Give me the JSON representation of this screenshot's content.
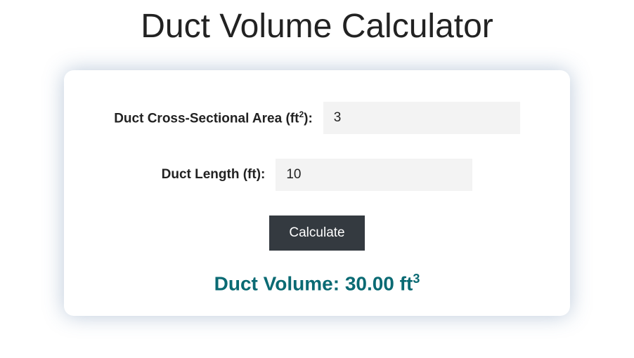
{
  "title": "Duct Volume Calculator",
  "form": {
    "area_label_pre": "Duct Cross-Sectional Area (ft",
    "area_label_sup": "2",
    "area_label_post": "):",
    "area_value": "3",
    "length_label": "Duct Length (ft):",
    "length_value": "10",
    "button_label": "Calculate"
  },
  "result": {
    "prefix": "Duct Volume: ",
    "value": "30.00",
    "unit_pre": " ft",
    "unit_sup": "3"
  }
}
